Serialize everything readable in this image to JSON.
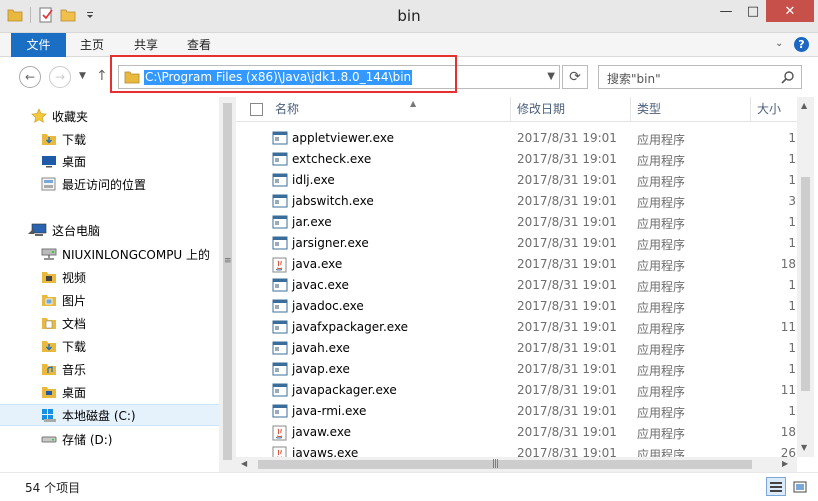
{
  "window": {
    "title": "bin",
    "buttons": {
      "minimize": "—",
      "maximize": "□",
      "close": "✕"
    }
  },
  "ribbon": {
    "tabs": [
      "文件",
      "主页",
      "共享",
      "查看"
    ]
  },
  "address": {
    "path": "C:\\Program Files (x86)\\Java\\jdk1.8.0_144\\bin",
    "search_placeholder": "搜索\"bin\""
  },
  "nav": {
    "favorites": "收藏夹",
    "downloads": "下载",
    "desktop": "桌面",
    "recent": "最近访问的位置",
    "this_pc": "这台电脑",
    "network_drive": "NIUXINLONGCOMPU 上的",
    "videos": "视频",
    "pictures": "图片",
    "documents": "文档",
    "downloads2": "下载",
    "music": "音乐",
    "desktop2": "桌面",
    "local_disk": "本地磁盘 (C:)",
    "storage": "存储 (D:)"
  },
  "columns": {
    "name": "名称",
    "date": "修改日期",
    "type": "类型",
    "size": "大小"
  },
  "files": [
    {
      "name": "appletviewer.exe",
      "date": "2017/8/31 19:01",
      "type": "应用程序",
      "size": "1",
      "icon": "app-window-icon"
    },
    {
      "name": "extcheck.exe",
      "date": "2017/8/31 19:01",
      "type": "应用程序",
      "size": "1",
      "icon": "app-window-icon"
    },
    {
      "name": "idlj.exe",
      "date": "2017/8/31 19:01",
      "type": "应用程序",
      "size": "1",
      "icon": "app-window-icon"
    },
    {
      "name": "jabswitch.exe",
      "date": "2017/8/31 19:01",
      "type": "应用程序",
      "size": "3",
      "icon": "app-window-icon"
    },
    {
      "name": "jar.exe",
      "date": "2017/8/31 19:01",
      "type": "应用程序",
      "size": "1",
      "icon": "app-window-icon"
    },
    {
      "name": "jarsigner.exe",
      "date": "2017/8/31 19:01",
      "type": "应用程序",
      "size": "1",
      "icon": "app-window-icon"
    },
    {
      "name": "java.exe",
      "date": "2017/8/31 19:01",
      "type": "应用程序",
      "size": "18",
      "icon": "java-icon"
    },
    {
      "name": "javac.exe",
      "date": "2017/8/31 19:01",
      "type": "应用程序",
      "size": "1",
      "icon": "app-window-icon"
    },
    {
      "name": "javadoc.exe",
      "date": "2017/8/31 19:01",
      "type": "应用程序",
      "size": "1",
      "icon": "app-window-icon"
    },
    {
      "name": "javafxpackager.exe",
      "date": "2017/8/31 19:01",
      "type": "应用程序",
      "size": "11",
      "icon": "app-window-icon"
    },
    {
      "name": "javah.exe",
      "date": "2017/8/31 19:01",
      "type": "应用程序",
      "size": "1",
      "icon": "app-window-icon"
    },
    {
      "name": "javap.exe",
      "date": "2017/8/31 19:01",
      "type": "应用程序",
      "size": "1",
      "icon": "app-window-icon"
    },
    {
      "name": "javapackager.exe",
      "date": "2017/8/31 19:01",
      "type": "应用程序",
      "size": "11",
      "icon": "app-window-icon"
    },
    {
      "name": "java-rmi.exe",
      "date": "2017/8/31 19:01",
      "type": "应用程序",
      "size": "1",
      "icon": "app-window-icon"
    },
    {
      "name": "javaw.exe",
      "date": "2017/8/31 19:01",
      "type": "应用程序",
      "size": "18",
      "icon": "java-icon"
    },
    {
      "name": "javaws.exe",
      "date": "2017/8/31 19:01",
      "type": "应用程序",
      "size": "26",
      "icon": "java-icon"
    }
  ],
  "status": {
    "item_count": "54 个项目"
  },
  "colors": {
    "accent": "#1a6fc5",
    "selection": "#3399ff",
    "highlight": "#e5302f",
    "close": "#c7504b"
  }
}
